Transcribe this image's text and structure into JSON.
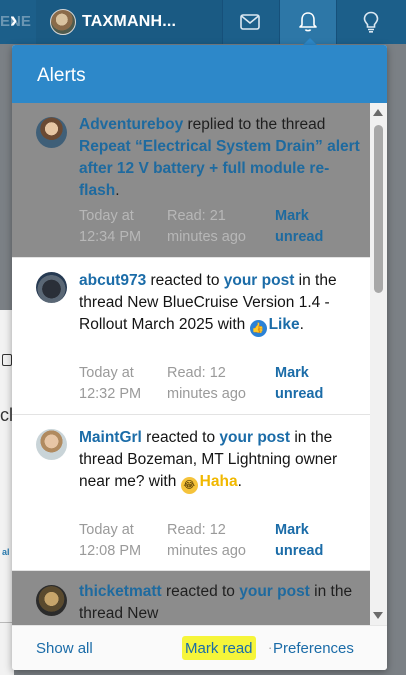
{
  "background": {
    "top_text": "ENE",
    "snip_1": "cl",
    "snip_2": "al"
  },
  "topbar": {
    "user_name": "TAXMANH...",
    "inbox_icon": "envelope-icon",
    "alerts_icon": "bell-icon",
    "bulb_icon": "lightbulb-icon"
  },
  "popup": {
    "title": "Alerts",
    "alerts": [
      {
        "state": "unread",
        "user": "Adventureboy",
        "action": " replied to the thread ",
        "thread": "Repeat “Electrical System Drain” alert after 12 V battery + full module re-flash",
        "trail": ".",
        "date": "Today at 12:34 PM",
        "read_status": "Read: 21 minutes ago",
        "mark_label": "Mark unread"
      },
      {
        "state": "read",
        "user": "abcut973",
        "action": " reacted to ",
        "post_link": "your post",
        "context": " in the thread New BlueCruise Version 1.4 - Rollout March 2025 with ",
        "reaction": "Like",
        "trail": ".",
        "date": "Today at 12:32 PM",
        "read_status": "Read: 12 minutes ago",
        "mark_label": "Mark unread"
      },
      {
        "state": "read",
        "user": "MaintGrl",
        "action": " reacted to ",
        "post_link": "your post",
        "context": " in the thread Bozeman, MT Lightning owner near me? with ",
        "reaction": "Haha",
        "trail": ".",
        "date": "Today at 12:08 PM",
        "read_status": "Read: 12 minutes ago",
        "mark_label": "Mark unread"
      },
      {
        "state": "unread",
        "user": "thicketmatt",
        "action": " reacted to ",
        "post_link": "your post",
        "context": " in the thread New"
      }
    ],
    "footer": {
      "show_all": "Show all",
      "mark_read": "Mark read",
      "separator": "·",
      "preferences": "Preferences"
    }
  },
  "colors": {
    "header_blue": "#2d88c9",
    "link_blue": "#1b6ca8",
    "highlight_yellow": "#f6f53a",
    "unread_gray": "#8c8c8c"
  }
}
